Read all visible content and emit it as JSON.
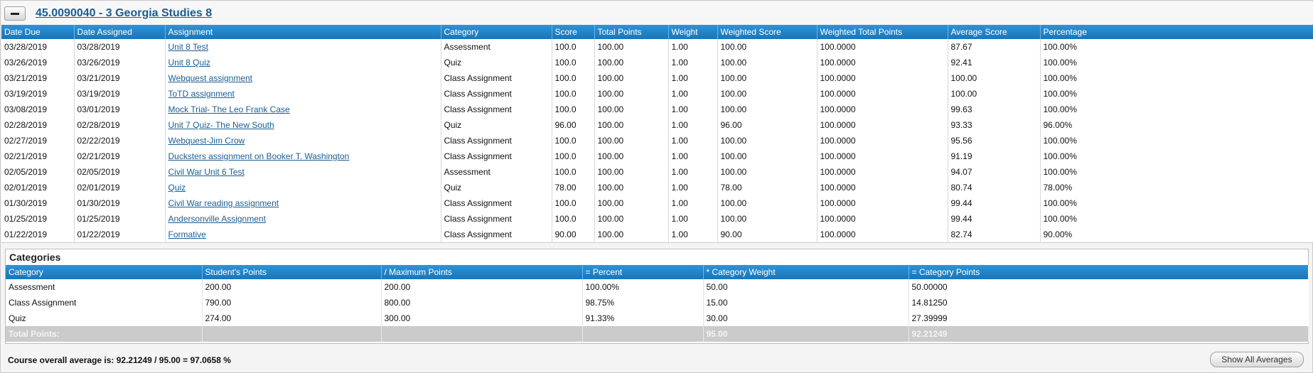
{
  "course": {
    "title": "45.0090040 - 3 Georgia Studies 8"
  },
  "assignments": {
    "columns": [
      "Date Due",
      "Date Assigned",
      "Assignment",
      "Category",
      "Score",
      "Total Points",
      "Weight",
      "Weighted Score",
      "Weighted Total Points",
      "Average Score",
      "Percentage"
    ],
    "rows": [
      [
        "03/28/2019",
        "03/28/2019",
        "Unit 8 Test",
        "Assessment",
        "100.0",
        "100.00",
        "1.00",
        "100.00",
        "100.0000",
        "87.67",
        "100.00%"
      ],
      [
        "03/26/2019",
        "03/26/2019",
        "Unit 8 Quiz",
        "Quiz",
        "100.0",
        "100.00",
        "1.00",
        "100.00",
        "100.0000",
        "92.41",
        "100.00%"
      ],
      [
        "03/21/2019",
        "03/21/2019",
        "Webquest assignment",
        "Class Assignment",
        "100.0",
        "100.00",
        "1.00",
        "100.00",
        "100.0000",
        "100.00",
        "100.00%"
      ],
      [
        "03/19/2019",
        "03/19/2019",
        "ToTD assignment",
        "Class Assignment",
        "100.0",
        "100.00",
        "1.00",
        "100.00",
        "100.0000",
        "100.00",
        "100.00%"
      ],
      [
        "03/08/2019",
        "03/01/2019",
        "Mock Trial- The Leo Frank Case",
        "Class Assignment",
        "100.0",
        "100.00",
        "1.00",
        "100.00",
        "100.0000",
        "99.63",
        "100.00%"
      ],
      [
        "02/28/2019",
        "02/28/2019",
        "Unit 7 Quiz- The New South",
        "Quiz",
        "96.00",
        "100.00",
        "1.00",
        "96.00",
        "100.0000",
        "93.33",
        "96.00%"
      ],
      [
        "02/27/2019",
        "02/22/2019",
        "Webquest-Jim Crow",
        "Class Assignment",
        "100.0",
        "100.00",
        "1.00",
        "100.00",
        "100.0000",
        "95.56",
        "100.00%"
      ],
      [
        "02/21/2019",
        "02/21/2019",
        "Ducksters assignment on Booker T. Washington",
        "Class Assignment",
        "100.0",
        "100.00",
        "1.00",
        "100.00",
        "100.0000",
        "91.19",
        "100.00%"
      ],
      [
        "02/05/2019",
        "02/05/2019",
        "Civil War Unit 6 Test",
        "Assessment",
        "100.0",
        "100.00",
        "1.00",
        "100.00",
        "100.0000",
        "94.07",
        "100.00%"
      ],
      [
        "02/01/2019",
        "02/01/2019",
        "Quiz",
        "Quiz",
        "78.00",
        "100.00",
        "1.00",
        "78.00",
        "100.0000",
        "80.74",
        "78.00%"
      ],
      [
        "01/30/2019",
        "01/30/2019",
        "Civil War reading assignment",
        "Class Assignment",
        "100.0",
        "100.00",
        "1.00",
        "100.00",
        "100.0000",
        "99.44",
        "100.00%"
      ],
      [
        "01/25/2019",
        "01/25/2019",
        "Andersonville Assignment",
        "Class Assignment",
        "100.0",
        "100.00",
        "1.00",
        "100.00",
        "100.0000",
        "99.44",
        "100.00%"
      ],
      [
        "01/22/2019",
        "01/22/2019",
        "Formative",
        "Class Assignment",
        "90.00",
        "100.00",
        "1.00",
        "90.00",
        "100.0000",
        "82.74",
        "90.00%"
      ]
    ]
  },
  "categories": {
    "title": "Categories",
    "columns": [
      "Category",
      "Student's Points",
      "/ Maximum Points",
      "= Percent",
      "* Category Weight",
      "= Category Points"
    ],
    "rows": [
      [
        "Assessment",
        "200.00",
        "200.00",
        "100.00%",
        "50.00",
        "50.00000"
      ],
      [
        "Class Assignment",
        "790.00",
        "800.00",
        "98.75%",
        "15.00",
        "14.81250"
      ],
      [
        "Quiz",
        "274.00",
        "300.00",
        "91.33%",
        "30.00",
        "27.39999"
      ]
    ],
    "total": [
      "Total Points:",
      "",
      "",
      "",
      "95.00",
      "92.21249"
    ]
  },
  "overall": {
    "text": "Course overall average is: 92.21249  /  95.00  =  97.0658 %"
  },
  "buttons": {
    "show_all": "Show All Averages"
  },
  "colors": {
    "header_blue": "#1f84c7",
    "link_blue": "#1b5d94",
    "total_row_gray": "#cbcbcb"
  }
}
